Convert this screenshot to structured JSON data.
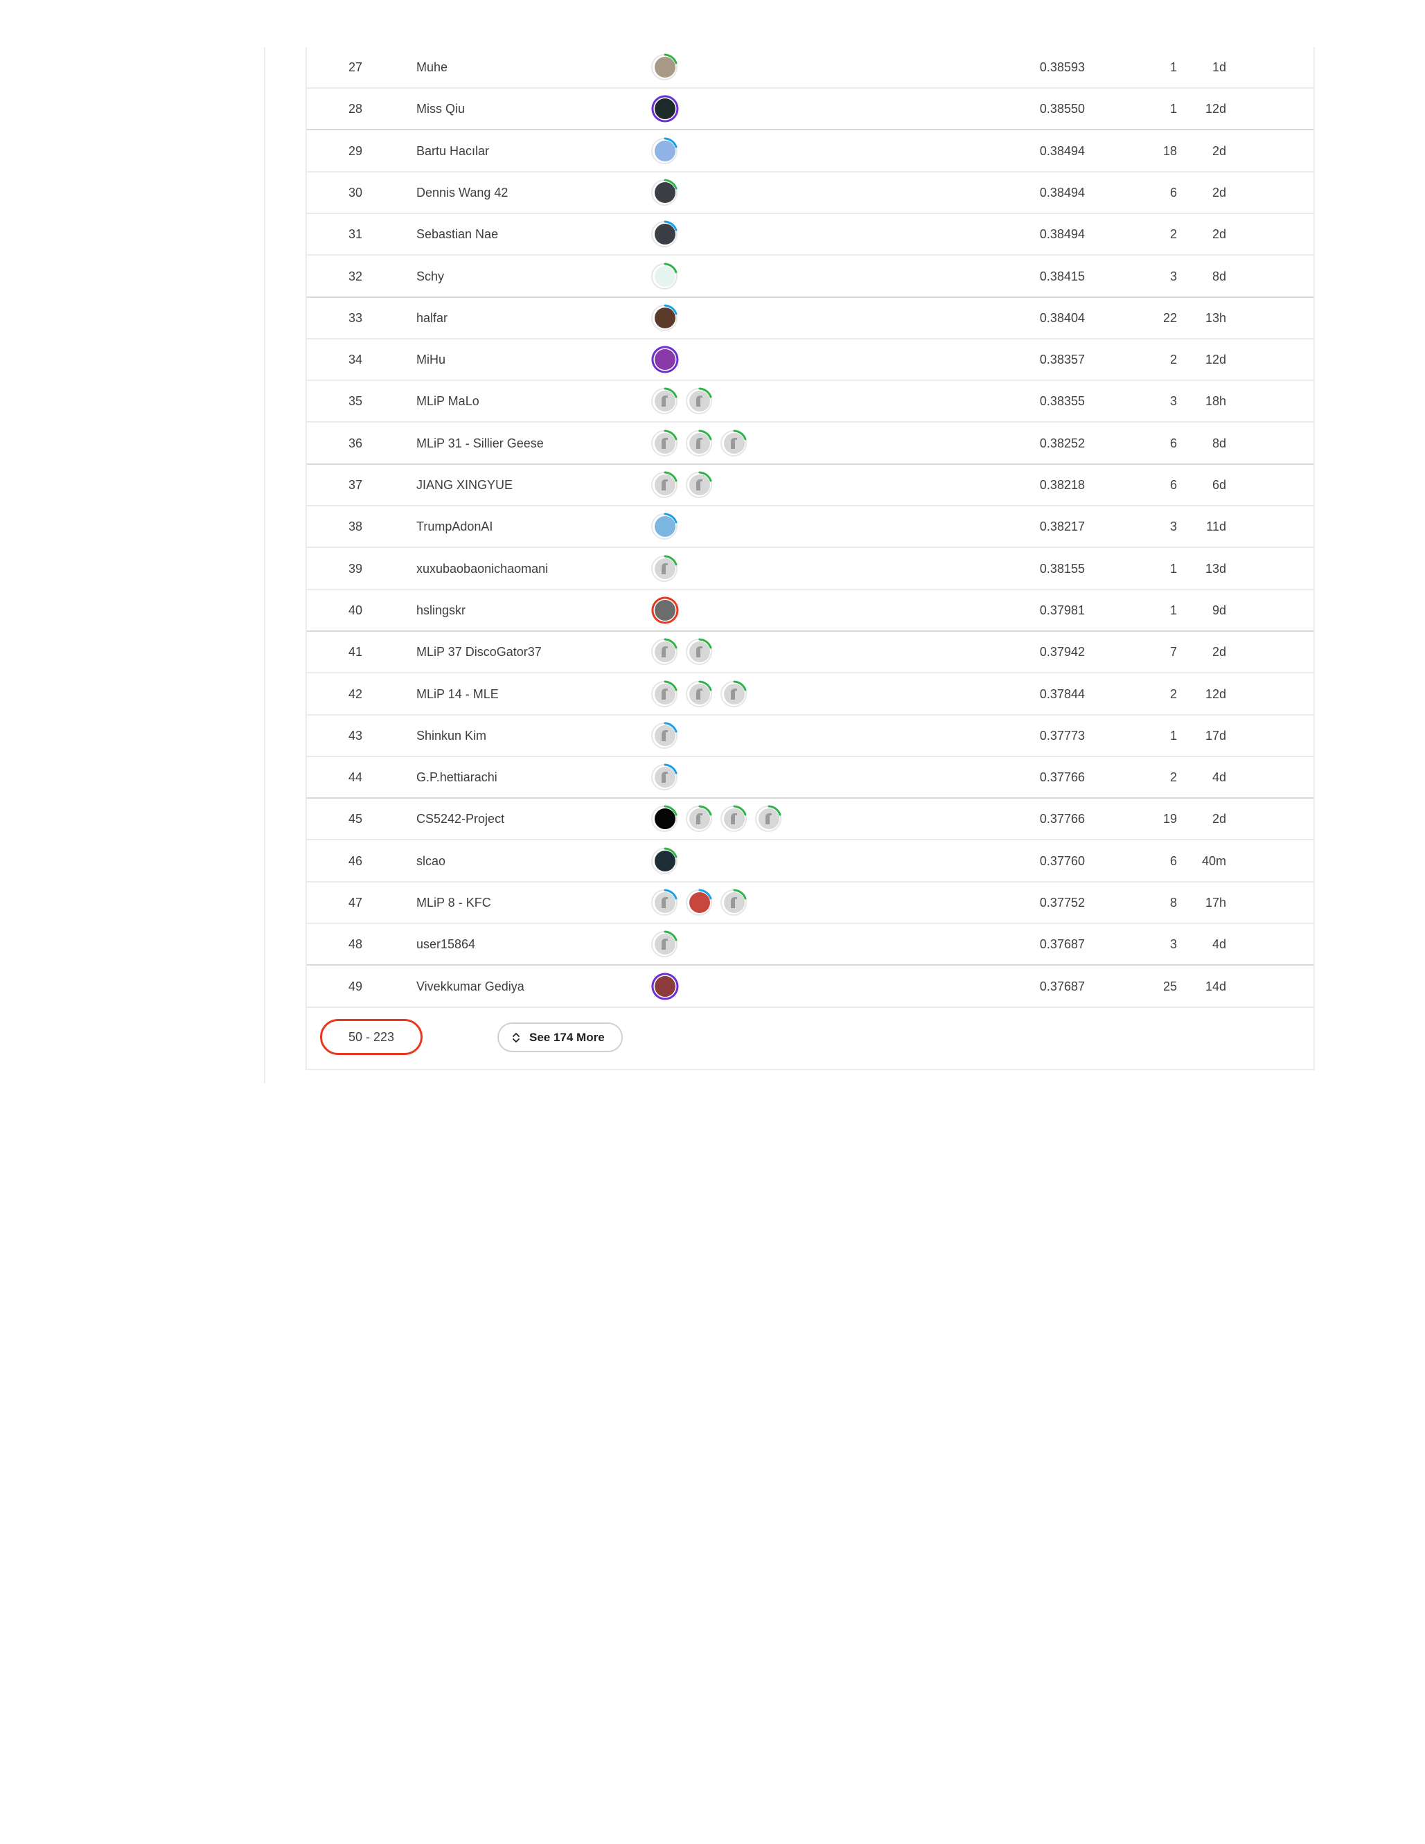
{
  "leaderboard": {
    "rows": [
      {
        "rank": "27",
        "team": "Muhe",
        "avatars": [
          {
            "kind": "photo-dog",
            "ring": "#2fb34a"
          }
        ],
        "score": "0.38593",
        "entries": "1",
        "last": "1d"
      },
      {
        "rank": "28",
        "team": "Miss Qiu",
        "avatars": [
          {
            "kind": "photo-dark",
            "ring": "#6b2fd6"
          }
        ],
        "score": "0.38550",
        "entries": "1",
        "last": "12d"
      },
      {
        "rank": "29",
        "team": "Bartu Hacılar",
        "avatars": [
          {
            "kind": "photo-sky",
            "ring": "#1aa0e6"
          }
        ],
        "score": "0.38494",
        "entries": "18",
        "last": "2d"
      },
      {
        "rank": "30",
        "team": "Dennis Wang 42",
        "avatars": [
          {
            "kind": "photo-person",
            "ring": "#2fb34a"
          }
        ],
        "score": "0.38494",
        "entries": "6",
        "last": "2d"
      },
      {
        "rank": "31",
        "team": "Sebastian Nae",
        "avatars": [
          {
            "kind": "photo-person",
            "ring": "#1aa0e6"
          }
        ],
        "score": "0.38494",
        "entries": "2",
        "last": "2d"
      },
      {
        "rank": "32",
        "team": "Schy",
        "avatars": [
          {
            "kind": "photo-light",
            "ring": "#2fb34a"
          }
        ],
        "score": "0.38415",
        "entries": "3",
        "last": "8d"
      },
      {
        "rank": "33",
        "team": "halfar",
        "avatars": [
          {
            "kind": "photo-face",
            "ring": "#1aa0e6"
          }
        ],
        "score": "0.38404",
        "entries": "22",
        "last": "13h"
      },
      {
        "rank": "34",
        "team": "MiHu",
        "avatars": [
          {
            "kind": "photo-cartoon",
            "ring": "#6b2fd6"
          }
        ],
        "score": "0.38357",
        "entries": "2",
        "last": "12d"
      },
      {
        "rank": "35",
        "team": "MLiP MaLo",
        "avatars": [
          {
            "kind": "default",
            "ring": "#2fb34a"
          },
          {
            "kind": "default",
            "ring": "#2fb34a"
          }
        ],
        "score": "0.38355",
        "entries": "3",
        "last": "18h"
      },
      {
        "rank": "36",
        "team": "MLiP 31 - Sillier Geese",
        "avatars": [
          {
            "kind": "default",
            "ring": "#2fb34a"
          },
          {
            "kind": "default",
            "ring": "#2fb34a"
          },
          {
            "kind": "default",
            "ring": "#2fb34a"
          }
        ],
        "score": "0.38252",
        "entries": "6",
        "last": "8d"
      },
      {
        "rank": "37",
        "team": "JIANG XINGYUE",
        "avatars": [
          {
            "kind": "default",
            "ring": "#2fb34a"
          },
          {
            "kind": "default",
            "ring": "#2fb34a"
          }
        ],
        "score": "0.38218",
        "entries": "6",
        "last": "6d"
      },
      {
        "rank": "38",
        "team": "TrumpAdonAI",
        "avatars": [
          {
            "kind": "photo-cartoon2",
            "ring": "#1aa0e6"
          }
        ],
        "score": "0.38217",
        "entries": "3",
        "last": "11d"
      },
      {
        "rank": "39",
        "team": "xuxubaobaonichaomani",
        "avatars": [
          {
            "kind": "default",
            "ring": "#2fb34a"
          }
        ],
        "score": "0.38155",
        "entries": "1",
        "last": "13d"
      },
      {
        "rank": "40",
        "team": "hslingskr",
        "avatars": [
          {
            "kind": "photo-grey",
            "ring": "#e8381f"
          }
        ],
        "score": "0.37981",
        "entries": "1",
        "last": "9d"
      },
      {
        "rank": "41",
        "team": "MLiP 37 DiscoGator37",
        "avatars": [
          {
            "kind": "default",
            "ring": "#2fb34a"
          },
          {
            "kind": "default",
            "ring": "#2fb34a"
          }
        ],
        "score": "0.37942",
        "entries": "7",
        "last": "2d"
      },
      {
        "rank": "42",
        "team": "MLiP 14 - MLE",
        "avatars": [
          {
            "kind": "default",
            "ring": "#2fb34a"
          },
          {
            "kind": "default",
            "ring": "#2fb34a"
          },
          {
            "kind": "default",
            "ring": "#2fb34a"
          }
        ],
        "score": "0.37844",
        "entries": "2",
        "last": "12d"
      },
      {
        "rank": "43",
        "team": "Shinkun Kim",
        "avatars": [
          {
            "kind": "default",
            "ring": "#1aa0e6"
          }
        ],
        "score": "0.37773",
        "entries": "1",
        "last": "17d"
      },
      {
        "rank": "44",
        "team": "G.P.hettiarachi",
        "avatars": [
          {
            "kind": "default",
            "ring": "#1aa0e6"
          }
        ],
        "score": "0.37766",
        "entries": "2",
        "last": "4d"
      },
      {
        "rank": "45",
        "team": "CS5242-Project",
        "avatars": [
          {
            "kind": "photo-black",
            "ring": "#2fb34a"
          },
          {
            "kind": "default",
            "ring": "#2fb34a"
          },
          {
            "kind": "default",
            "ring": "#2fb34a"
          },
          {
            "kind": "default",
            "ring": "#2fb34a"
          }
        ],
        "score": "0.37766",
        "entries": "19",
        "last": "2d"
      },
      {
        "rank": "46",
        "team": "slcao",
        "avatars": [
          {
            "kind": "photo-dark2",
            "ring": "#2fb34a"
          }
        ],
        "score": "0.37760",
        "entries": "6",
        "last": "40m"
      },
      {
        "rank": "47",
        "team": "MLiP 8 - KFC",
        "avatars": [
          {
            "kind": "default",
            "ring": "#1aa0e6"
          },
          {
            "kind": "photo-red",
            "ring": "#1aa0e6"
          },
          {
            "kind": "default",
            "ring": "#2fb34a"
          }
        ],
        "score": "0.37752",
        "entries": "8",
        "last": "17h"
      },
      {
        "rank": "48",
        "team": "user15864",
        "avatars": [
          {
            "kind": "default",
            "ring": "#2fb34a"
          }
        ],
        "score": "0.37687",
        "entries": "3",
        "last": "4d"
      },
      {
        "rank": "49",
        "team": "Vivekkumar Gediya",
        "avatars": [
          {
            "kind": "photo-person2",
            "ring": "#6b2fd6"
          }
        ],
        "score": "0.37687",
        "entries": "25",
        "last": "14d"
      }
    ]
  },
  "footer": {
    "range_label": "50 - 223",
    "see_more_label": "See 174 More",
    "see_more_icon": "unfold-icon"
  }
}
